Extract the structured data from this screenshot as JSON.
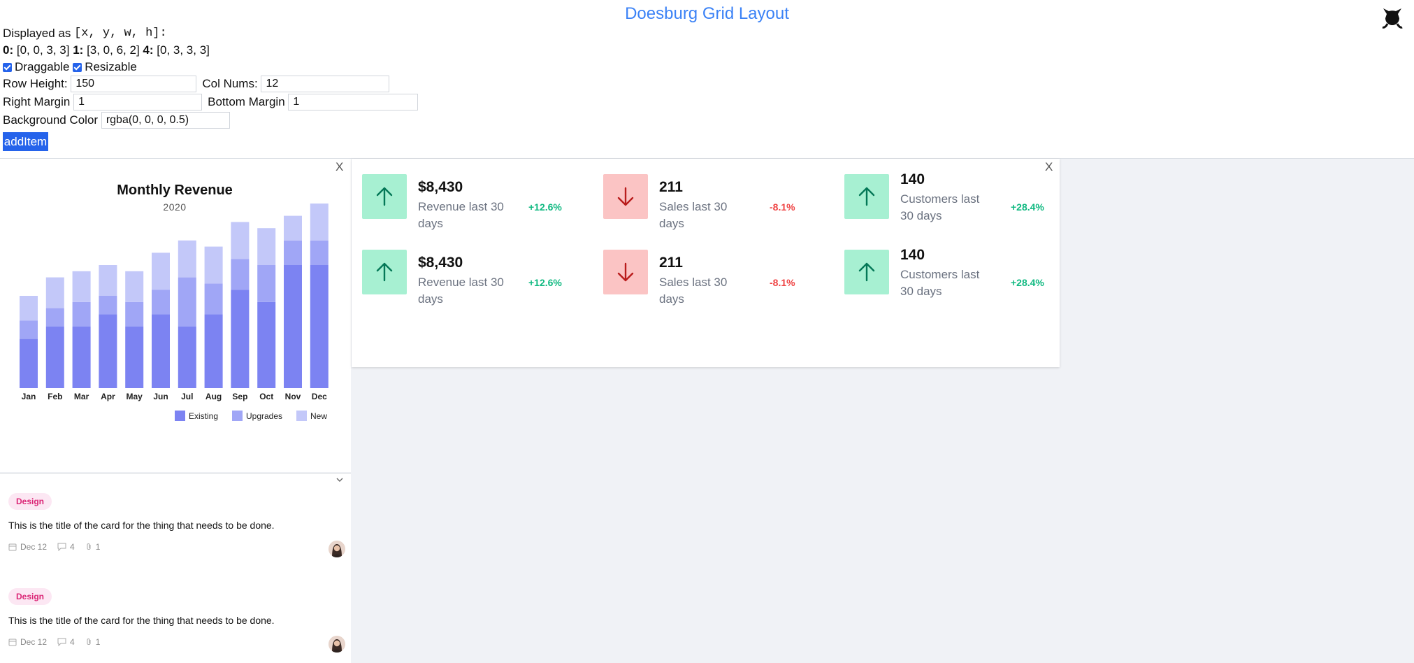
{
  "header": {
    "title": "Doesburg Grid Layout"
  },
  "layout_info": {
    "caption": "Displayed as",
    "format": "[x, y, w, h]:",
    "items": [
      {
        "key": "0:",
        "value": "[0, 0, 3, 3]"
      },
      {
        "key": "1:",
        "value": "[3, 0, 6, 2]"
      },
      {
        "key": "4:",
        "value": "[0, 3, 3, 3]"
      }
    ]
  },
  "options": {
    "draggable_label": "Draggable",
    "resizable_label": "Resizable"
  },
  "fields": {
    "row_height": {
      "label": "Row Height:",
      "value": "150"
    },
    "col_nums": {
      "label": "Col Nums:",
      "value": "12"
    },
    "right_margin": {
      "label": "Right Margin",
      "value": "1"
    },
    "bottom_margin": {
      "label": "Bottom Margin",
      "value": "1"
    },
    "background_color": {
      "label": "Background Color",
      "value": "rgba(0,  0, 0, 0.5)"
    }
  },
  "add_button": "addItem",
  "close_label": "X",
  "chart_data": {
    "type": "bar",
    "title": "Monthly Revenue",
    "subtitle": "2020",
    "stacked": true,
    "categories": [
      "Jan",
      "Feb",
      "Mar",
      "Apr",
      "May",
      "Jun",
      "Jul",
      "Aug",
      "Sep",
      "Oct",
      "Nov",
      "Dec"
    ],
    "ylim": [
      0,
      300
    ],
    "series": [
      {
        "name": "Existing",
        "color": "#7c83f2",
        "values": [
          80,
          100,
          100,
          120,
          100,
          120,
          100,
          120,
          160,
          140,
          200,
          200
        ]
      },
      {
        "name": "Upgrades",
        "color": "#a0a6f6",
        "values": [
          30,
          30,
          40,
          30,
          40,
          40,
          80,
          50,
          50,
          60,
          40,
          40
        ]
      },
      {
        "name": "New",
        "color": "#c3c8f9",
        "values": [
          40,
          50,
          50,
          50,
          50,
          60,
          60,
          60,
          60,
          60,
          40,
          60
        ]
      }
    ],
    "legend": "bottom-right",
    "grid": false
  },
  "stats": [
    {
      "value": "$8,430",
      "label": "Revenue last 30 days",
      "change": "+12.6%",
      "direction": "up"
    },
    {
      "value": "211",
      "label": "Sales last 30 days",
      "change": "-8.1%",
      "direction": "down"
    },
    {
      "value": "140",
      "label": "Customers last 30 days",
      "change": "+28.4%",
      "direction": "up"
    },
    {
      "value": "$8,430",
      "label": "Revenue last 30 days",
      "change": "+12.6%",
      "direction": "up"
    },
    {
      "value": "211",
      "label": "Sales last 30 days",
      "change": "-8.1%",
      "direction": "down"
    },
    {
      "value": "140",
      "label": "Customers last 30 days",
      "change": "+28.4%",
      "direction": "up"
    }
  ],
  "cards": [
    {
      "tag": "Design",
      "title": "This is the title of the card for the thing that needs to be done.",
      "date": "Dec 12",
      "comments": "4",
      "attachments": "1"
    },
    {
      "tag": "Design",
      "title": "This is the title of the card for the thing that needs to be done.",
      "date": "Dec 12",
      "comments": "4",
      "attachments": "1"
    }
  ]
}
